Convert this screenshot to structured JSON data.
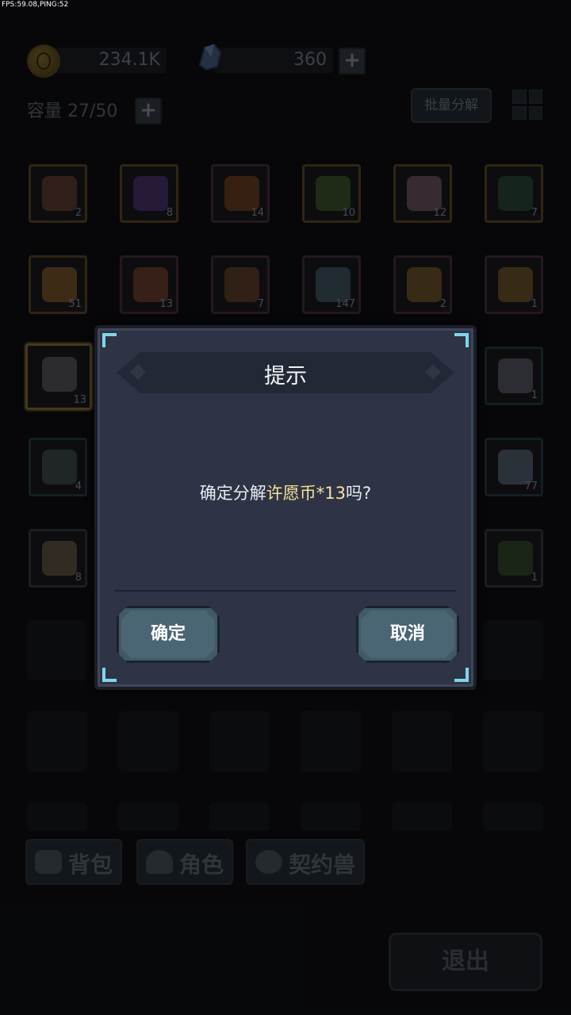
{
  "debug": {
    "fps_text": "FPS:59.08,PING:52"
  },
  "resources": {
    "gold_value": "234.1K",
    "gem_value": "360"
  },
  "inventory": {
    "capacity_label": "容量 27/50",
    "batch_decompose_label": "批量分解",
    "items": [
      {
        "name": "mushroom",
        "count": "2",
        "rarity": "gold",
        "color": "#7a4a36"
      },
      {
        "name": "purple-stone",
        "count": "8",
        "rarity": "gold",
        "color": "#5b3a8a"
      },
      {
        "name": "fire-essence",
        "count": "14",
        "rarity": "purple",
        "color": "#8a4a1e"
      },
      {
        "name": "green-bud",
        "count": "10",
        "rarity": "gold",
        "color": "#4a6a2e"
      },
      {
        "name": "striped-egg",
        "count": "12",
        "rarity": "gold",
        "color": "#8a6a7a"
      },
      {
        "name": "green-bush",
        "count": "7",
        "rarity": "gold",
        "color": "#2e5a3a"
      },
      {
        "name": "crystal-cluster",
        "count": "51",
        "rarity": "gold",
        "color": "#9a6a2a"
      },
      {
        "name": "meat-drumstick",
        "count": "13",
        "rarity": "purple",
        "color": "#8a4a2e"
      },
      {
        "name": "potion-bottle",
        "count": "7",
        "rarity": "purple",
        "color": "#7a4a2a"
      },
      {
        "name": "scroll-map",
        "count": "147",
        "rarity": "purple",
        "color": "#4a6a7a"
      },
      {
        "name": "gold-key",
        "count": "2",
        "rarity": "purple",
        "color": "#8a6a2a"
      },
      {
        "name": "bronze-key",
        "count": "1",
        "rarity": "purple",
        "color": "#8a6a2a"
      },
      {
        "name": "wish-statue",
        "count": "13",
        "rarity": "sel",
        "color": "#6a6a72"
      },
      {
        "name": "armor-piece",
        "count": "1",
        "rarity": "teal",
        "color": "#6a7078"
      },
      {
        "name": "ring",
        "count": "4",
        "rarity": "teal",
        "color": "#4a5a5a"
      },
      {
        "name": "ice-crystal",
        "count": "77",
        "rarity": "teal",
        "color": "#6a7a8a"
      },
      {
        "name": "claw",
        "count": "8",
        "rarity": "grey",
        "color": "#7a6a4a"
      },
      {
        "name": "leaves",
        "count": "1",
        "rarity": "grey",
        "color": "#3a5a2a"
      }
    ]
  },
  "tabs": [
    {
      "label": "背包"
    },
    {
      "label": "角色"
    },
    {
      "label": "契约兽"
    }
  ],
  "exit_label": "退出",
  "dialog": {
    "title": "提示",
    "message_prefix": "确定分解",
    "message_item": "许愿币*13",
    "message_suffix": "吗?",
    "confirm_label": "确定",
    "cancel_label": "取消"
  }
}
